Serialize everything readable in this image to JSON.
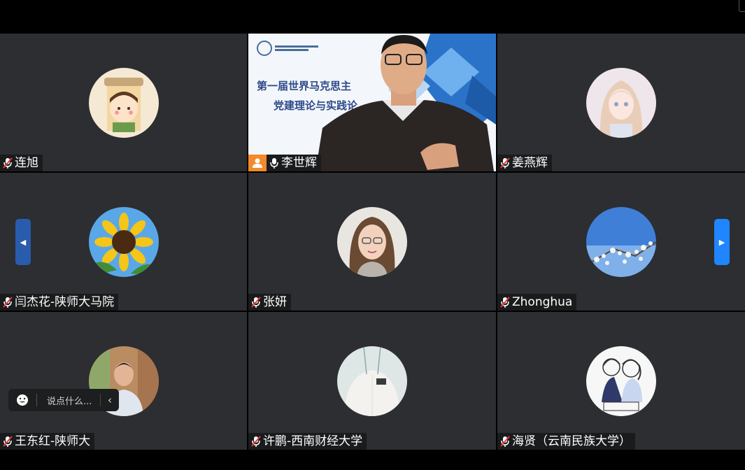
{
  "participants": [
    {
      "name": "连旭",
      "mic": "muted",
      "avatar": "cartoon-girl-cup-avatar"
    },
    {
      "name": "李世辉",
      "mic": "active",
      "avatar": "presenter-video",
      "host": true,
      "slide": {
        "title_line1": "第一届世界马克思主",
        "title_line2": "党建理论与实践论"
      }
    },
    {
      "name": "姜燕辉",
      "mic": "muted",
      "avatar": "anime-girl-avatar"
    },
    {
      "name": "闫杰花-陕师大马院",
      "mic": "muted",
      "avatar": "sunflower-avatar"
    },
    {
      "name": "张妍",
      "mic": "muted",
      "avatar": "woman-glasses-avatar"
    },
    {
      "name": "Zhonghua",
      "mic": "muted",
      "avatar": "blossom-sky-avatar"
    },
    {
      "name": "王东红-陕师大",
      "mic": "muted",
      "avatar": "man-photo-avatar"
    },
    {
      "name": "许鹏-西南财经大学",
      "mic": "muted",
      "avatar": "white-shirt-avatar"
    },
    {
      "name": "海贤（云南民族大学）",
      "mic": "muted",
      "avatar": "sketch-couple-avatar"
    }
  ],
  "chat": {
    "placeholder": "说点什么..."
  },
  "colors": {
    "tile": "#2c2e31",
    "nameplate": "#1a1b1d",
    "host": "#f28a2a",
    "active_border": "#3fb36b",
    "nav_button": "#1f86ff"
  },
  "icons": {
    "muted": "mic-muted-icon",
    "active": "mic-icon",
    "host": "host-icon",
    "emoji": "emoji-icon",
    "collapse": "chevron-left-icon"
  }
}
